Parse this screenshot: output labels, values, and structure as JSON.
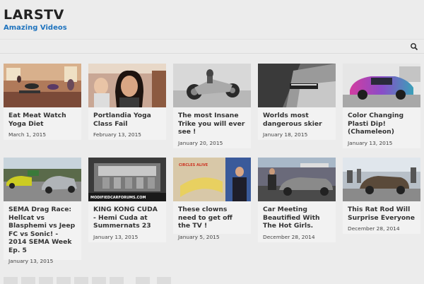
{
  "site": {
    "title": "LARSTV",
    "tagline": "Amazing Videos"
  },
  "nav": {
    "search_icon": "search-icon"
  },
  "posts": [
    {
      "title": "Eat Meat Watch Yoga Diet",
      "date": "March 1, 2015"
    },
    {
      "title": "Portlandia Yoga Class Fail",
      "date": "February 13, 2015"
    },
    {
      "title": "The most Insane Trike you will ever see !",
      "date": "January 20, 2015"
    },
    {
      "title": "Worlds most dangerous skier",
      "date": "January 18, 2015"
    },
    {
      "title": "Color Changing Plasti Dip! (Chameleon)",
      "date": "January 13, 2015"
    },
    {
      "title": "SEMA Drag Race: Hellcat vs Blasphemi vs Jeep FC vs Sonic! - 2014 SEMA Week Ep. 5",
      "date": "January 13, 2015"
    },
    {
      "title": "KING KONG CUDA - Hemi Cuda at Summernats 23",
      "date": "January 13, 2015",
      "thumb_caption": "MODIFIEDCARFORUMS.COM"
    },
    {
      "title": "These clowns need to get off the TV !",
      "date": "January 5, 2015",
      "thumb_caption": "CIRCLES ALIVE"
    },
    {
      "title": "Car Meeting Beautified With The Hot Girls.",
      "date": "December 28, 2014"
    },
    {
      "title": "This Rat Rod Will Surprise Everyone",
      "date": "December 28, 2014"
    }
  ],
  "colors": {
    "accent": "#1e73be",
    "background": "#ececec",
    "card": "#f2f2f2"
  }
}
